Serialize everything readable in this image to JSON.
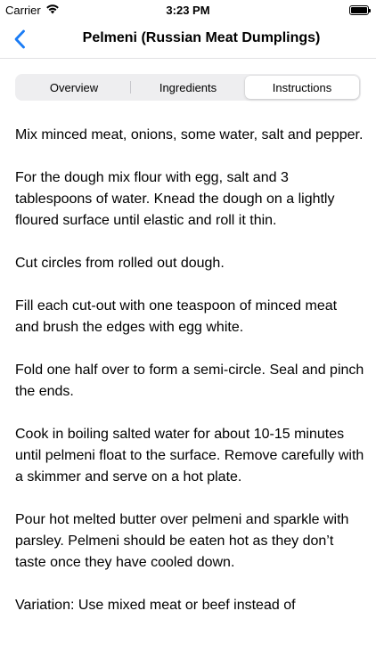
{
  "status_bar": {
    "carrier": "Carrier",
    "time": "3:23 PM",
    "wifi_icon": "wifi-icon",
    "battery_icon": "battery-icon"
  },
  "nav": {
    "back_icon": "chevron-left-icon",
    "title": "Pelmeni (Russian Meat Dumplings)",
    "accent_color": "#1a7cf5"
  },
  "tabs": [
    {
      "label": "Overview",
      "selected": false
    },
    {
      "label": "Ingredients",
      "selected": false
    },
    {
      "label": "Instructions",
      "selected": true
    }
  ],
  "instructions": [
    "Mix minced meat, onions, some water, salt and pepper.",
    "For the dough mix flour with egg, salt and 3 tablespoons of water. Knead the dough on a lightly floured surface until elastic and roll it thin.",
    "Cut circles from rolled out dough.",
    "Fill each cut-out with one teaspoon of minced meat and brush the edges with egg white.",
    "Fold one half over to form a semi-circle. Seal and pinch the ends.",
    "Cook in boiling salted water for about 10-15 minutes until pelmeni float to the surface. Remove carefully with a skimmer and serve on a hot plate.",
    "Pour hot melted butter over pelmeni and sparkle with parsley. Pelmeni should be eaten hot as they don’t taste once they have cooled down.",
    "Variation: Use mixed meat or beef instead of"
  ]
}
